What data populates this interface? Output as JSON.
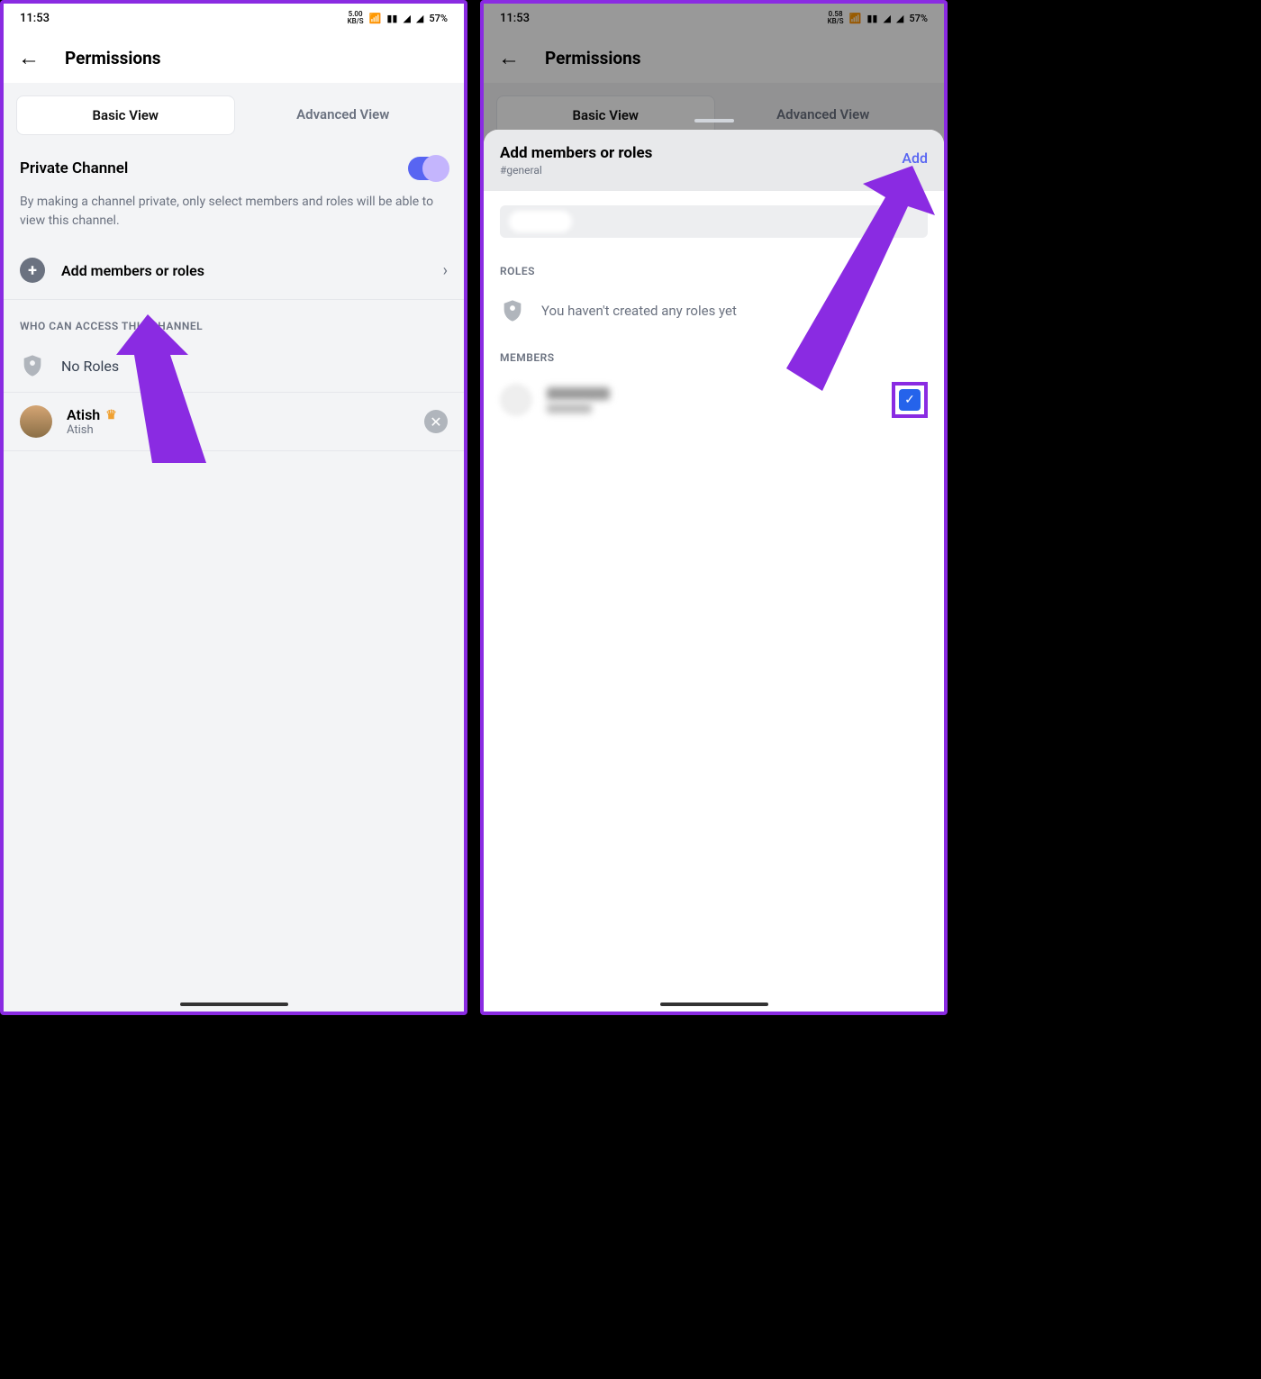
{
  "status": {
    "time": "11:53",
    "battery": "57%",
    "kbs1": "5.00",
    "kbs2": "0.58"
  },
  "header": {
    "title": "Permissions"
  },
  "tabs": {
    "basic": "Basic View",
    "advanced": "Advanced View"
  },
  "private": {
    "title": "Private Channel",
    "desc": "By making a channel private, only select members and roles will be able to view this channel."
  },
  "add_row": {
    "label": "Add members or roles"
  },
  "access": {
    "label": "WHO CAN ACCESS THIS CHANNEL",
    "no_roles": "No Roles",
    "member_name": "Atish",
    "member_sub": "Atish"
  },
  "sheet": {
    "title": "Add members or roles",
    "channel": "#general",
    "add_btn": "Add",
    "roles_label": "ROLES",
    "roles_empty": "You haven't created any roles yet",
    "members_label": "MEMBERS"
  }
}
